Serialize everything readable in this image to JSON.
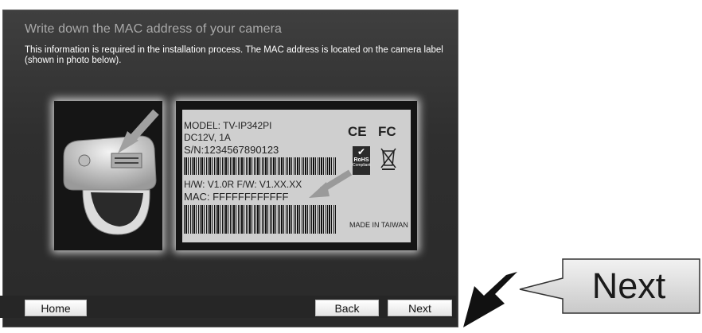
{
  "wizard": {
    "title": "Write down the MAC address of your camera",
    "description": "This information is required in the installation process. The MAC address is located on the camera label (shown in photo below)."
  },
  "label": {
    "model": "MODEL:  TV-IP342PI",
    "power": "DC12V, 1A",
    "serial": "S/N:1234567890123",
    "hw_fw": "H/W: V1.0R  F/W: V1.XX.XX",
    "mac": "MAC: FFFFFFFFFFFF",
    "ce": "CE",
    "fc": "FC",
    "rohs_line1": "RoHS",
    "rohs_line2": "Compliant",
    "made_in": "MADE IN TAIWAN"
  },
  "buttons": {
    "home": "Home",
    "back": "Back",
    "next": "Next"
  },
  "callout": {
    "text": "Next"
  },
  "colors": {
    "panel_bg": "#2f2f2f",
    "title_color": "#a9a9a9",
    "sticker": "#cfcfcf"
  }
}
